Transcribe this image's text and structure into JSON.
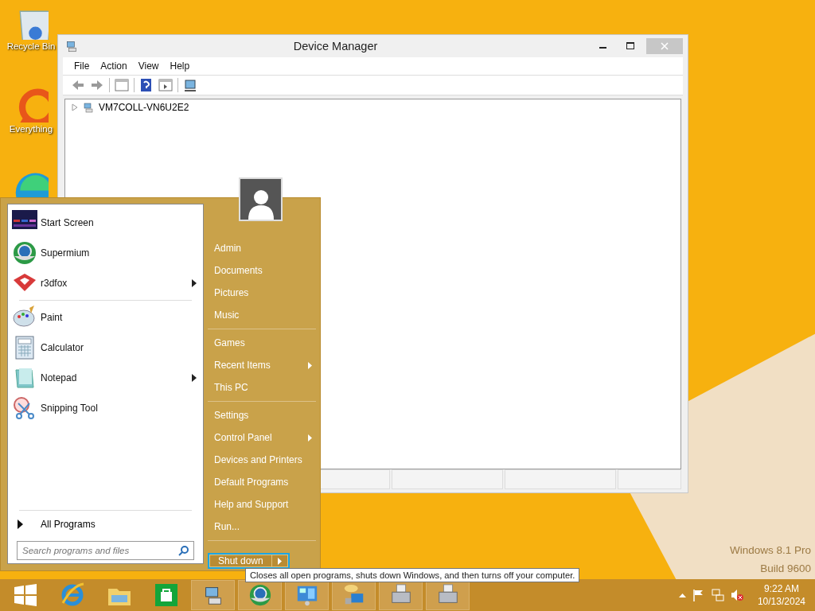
{
  "desktop_icons": [
    {
      "kind": "recycle",
      "label": "Recycle Bin"
    },
    {
      "kind": "search",
      "label": "Everything"
    },
    {
      "kind": "browser"
    }
  ],
  "watermark": [
    "Windows 8.1 Pro",
    "Build 9600"
  ],
  "window": {
    "title": "Device Manager",
    "menu": [
      "File",
      "Action",
      "View",
      "Help"
    ],
    "tree": [
      {
        "label": "VM7COLL-VN6U2E2",
        "expanded": false
      }
    ]
  },
  "start_menu": {
    "programs": [
      [
        {
          "kind": "start",
          "label": "Start Screen",
          "submenu": false
        },
        {
          "kind": "globe",
          "label": "Supermium",
          "submenu": false
        },
        {
          "kind": "fox",
          "label": "r3dfox",
          "submenu": true
        }
      ],
      [
        {
          "kind": "paint",
          "label": "Paint",
          "submenu": false
        },
        {
          "kind": "calc",
          "label": "Calculator",
          "submenu": false
        },
        {
          "kind": "notepad",
          "label": "Notepad",
          "submenu": true
        },
        {
          "kind": "snip",
          "label": "Snipping Tool",
          "submenu": false
        }
      ]
    ],
    "all_programs": "All Programs",
    "search": {
      "placeholder": "Search programs and files"
    },
    "places": [
      [
        {
          "label": "Admin",
          "submenu": false
        },
        {
          "label": "Documents",
          "submenu": false
        },
        {
          "label": "Pictures",
          "submenu": false
        },
        {
          "label": "Music",
          "submenu": false
        }
      ],
      [
        {
          "label": "Games",
          "submenu": false
        },
        {
          "label": "Recent Items",
          "submenu": true
        },
        {
          "label": "This PC",
          "submenu": false
        }
      ],
      [
        {
          "label": "Settings",
          "submenu": false
        },
        {
          "label": "Control Panel",
          "submenu": true
        },
        {
          "label": "Devices and Printers",
          "submenu": false
        },
        {
          "label": "Default Programs",
          "submenu": false
        },
        {
          "label": "Help and Support",
          "submenu": false
        },
        {
          "label": "Run...",
          "submenu": false
        }
      ]
    ],
    "shutdown": {
      "label": "Shut down",
      "focused": true
    },
    "tooltip": "Closes all open programs, shuts down Windows, and then turns off your computer."
  },
  "taskbar": {
    "pinned": [
      {
        "kind": "ie"
      },
      {
        "kind": "folder"
      },
      {
        "kind": "store"
      }
    ],
    "running": [
      {
        "kind": "devmgr"
      },
      {
        "kind": "globe"
      },
      {
        "kind": "panel"
      },
      {
        "kind": "network"
      },
      {
        "kind": "printer"
      },
      {
        "kind": "printer"
      }
    ],
    "clock": {
      "time": "9:22 AM",
      "date": "10/13/2024"
    }
  }
}
